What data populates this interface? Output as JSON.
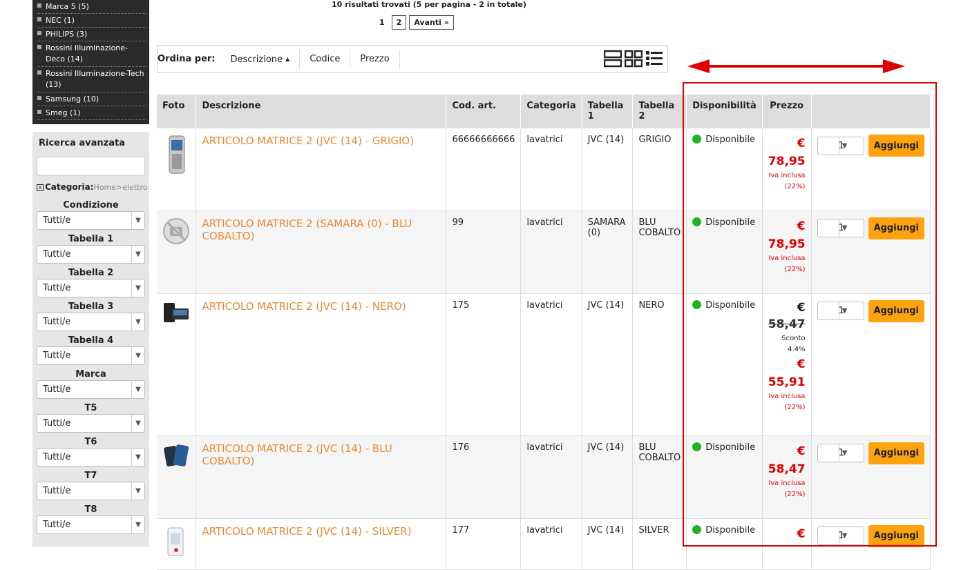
{
  "brands": [
    {
      "label": "Marca 5 (5)"
    },
    {
      "label": "NEC (1)"
    },
    {
      "label": "PHILIPS (3)"
    },
    {
      "label": "Rossini Illuminazione-Deco (14)"
    },
    {
      "label": "Rossini Illuminazione-Tech (13)"
    },
    {
      "label": "Samsung (10)"
    },
    {
      "label": "Smeg (1)"
    }
  ],
  "advanced_search": {
    "title": "Ricerca avanzata",
    "search_value": "",
    "category_label": "Categoria:",
    "category_path": "Home>elettrodomestici",
    "filters": [
      {
        "label": "Condizione",
        "value": "Tutti/e"
      },
      {
        "label": "Tabella 1",
        "value": "Tutti/e"
      },
      {
        "label": "Tabella 2",
        "value": "Tutti/e"
      },
      {
        "label": "Tabella 3",
        "value": "Tutti/e"
      },
      {
        "label": "Tabella 4",
        "value": "Tutti/e"
      },
      {
        "label": "Marca",
        "value": "Tutti/e"
      },
      {
        "label": "T5",
        "value": "Tutti/e"
      },
      {
        "label": "T6",
        "value": "Tutti/e"
      },
      {
        "label": "T7",
        "value": "Tutti/e"
      },
      {
        "label": "T8",
        "value": "Tutti/e"
      }
    ]
  },
  "results_text": "10 risultati trovati (5 per pagina - 2 in totale)",
  "pager": {
    "p1": "1",
    "p2": "2",
    "next": "Avanti »"
  },
  "sort": {
    "label": "Ordina per:",
    "options": [
      "Descrizione",
      "Codice",
      "Prezzo"
    ],
    "view_icons": [
      "large-grid-icon",
      "grid-icon",
      "list-icon"
    ]
  },
  "table": {
    "headers": [
      "Foto",
      "Descrizione",
      "Cod. art.",
      "Categoria",
      "Tabella 1",
      "Tabella 2",
      "Disponibilità",
      "Prezzo",
      ""
    ],
    "rows": [
      {
        "desc": "ARTICOLO MATRICE 2 (JVC (14) - GRIGIO)",
        "code": "66666666666",
        "cat": "lavatrici",
        "t1": "JVC (14)",
        "t2": "GRIGIO",
        "disp": "Disponibile",
        "eur": "€",
        "price": "78,95",
        "iva": "Iva inclusa (22%)",
        "qty": "1",
        "add": "Aggiungi",
        "photo": "phone-silver"
      },
      {
        "desc": "ARTICOLO MATRICE 2 (SAMARA (0) - BLU COBALTO)",
        "code": "99",
        "cat": "lavatrici",
        "t1": "SAMARA (0)",
        "t2": "BLU COBALTO",
        "disp": "Disponibile",
        "eur": "€",
        "price": "78,95",
        "iva": "Iva inclusa (22%)",
        "qty": "1",
        "add": "Aggiungi",
        "photo": "no-photo"
      },
      {
        "desc": "ARTICOLO MATRICE 2 (JVC (14) - NERO)",
        "code": "175",
        "cat": "lavatrici",
        "t1": "JVC (14)",
        "t2": "NERO",
        "disp": "Disponibile",
        "eur_old": "€",
        "old_price": "58,47",
        "discount": "Sconto 4.4%",
        "eur": "€",
        "price": "55,91",
        "iva": "Iva inclusa (22%)",
        "qty": "1",
        "add": "Aggiungi",
        "photo": "phone-black"
      },
      {
        "desc": "ARTICOLO MATRICE 2 (JVC (14) - BLU COBALTO)",
        "code": "176",
        "cat": "lavatrici",
        "t1": "JVC (14)",
        "t2": "BLU COBALTO",
        "disp": "Disponibile",
        "eur": "€",
        "price": "58,47",
        "iva": "Iva inclusa (22%)",
        "qty": "1",
        "add": "Aggiungi",
        "photo": "phone-blue"
      },
      {
        "desc": "ARTICOLO MATRICE 2 (JVC (14) - SILVER)",
        "code": "177",
        "cat": "lavatrici",
        "t1": "JVC (14)",
        "t2": "SILVER",
        "disp": "Disponibile",
        "eur": "€",
        "price": "",
        "iva": "",
        "qty": "1",
        "add": "Aggiungi",
        "photo": "phone-white"
      }
    ]
  },
  "colors": {
    "accent_orange": "#ffa20f",
    "link_orange": "#ee8833",
    "price_red": "#e00000",
    "available_green": "#22a022",
    "highlight_red": "#e00000"
  }
}
